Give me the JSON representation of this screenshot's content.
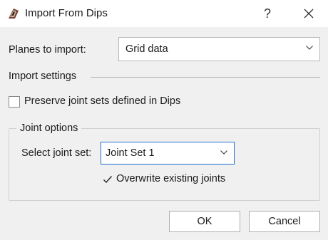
{
  "window": {
    "title": "Import From Dips",
    "help_glyph": "?",
    "close_icon": "close-icon",
    "app_icon": "dips-app-icon"
  },
  "planes": {
    "label": "Planes to import:",
    "value": "Grid data"
  },
  "import_settings": {
    "heading": "Import settings",
    "preserve_label": "Preserve joint sets defined in Dips",
    "preserve_checked": false
  },
  "joint_options": {
    "title": "Joint options",
    "select_label": "Select joint set:",
    "select_value": "Joint Set 1",
    "overwrite_label": "Overwrite existing joints",
    "overwrite_checked": true
  },
  "buttons": {
    "ok": "OK",
    "cancel": "Cancel"
  },
  "colors": {
    "focus_border": "#1f6fd1",
    "background": "#f0f0f0",
    "titlebar": "#ffffff"
  }
}
